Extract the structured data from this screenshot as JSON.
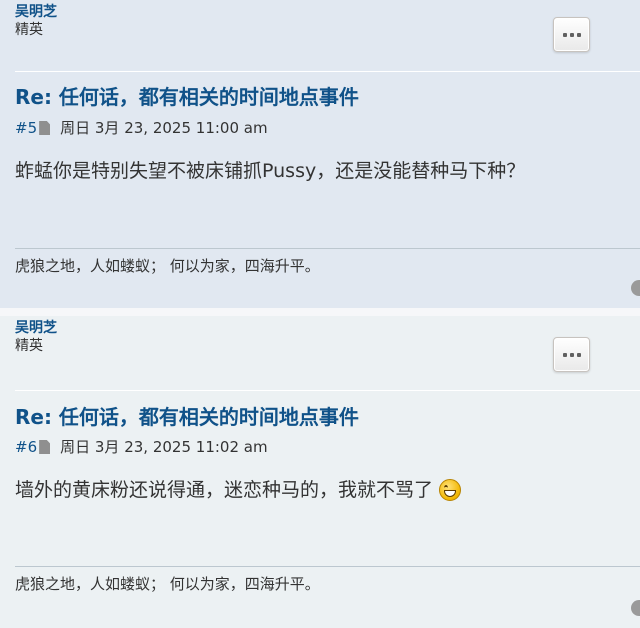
{
  "posts": [
    {
      "author": "吴明芝",
      "rank": "精英",
      "title": "Re: 任何话，都有相关的时间地点事件",
      "post_number": "#5",
      "date": "周日 3月 23, 2025 11:00 am",
      "content": "蚱蜢你是特别失望不被床铺抓Pussy，还是没能替种马下种？",
      "signature": "虎狼之地，人如蝼蚁； 何以为家，四海升平。"
    },
    {
      "author": "吴明芝",
      "rank": "精英",
      "title": "Re: 任何话，都有相关的时间地点事件",
      "post_number": "#6",
      "date": "周日 3月 23, 2025 11:02 am",
      "content": "墙外的黄床粉还说得通，迷恋种马的，我就不骂了",
      "content_emoji": "grinning-smiley-icon",
      "signature": "虎狼之地，人如蝼蚁； 何以为家，四海升平。"
    }
  ],
  "icons": {
    "post_link_icon": "document-icon",
    "menu_icon": "ellipsis-icon"
  },
  "colors": {
    "link_blue": "#105289",
    "post_bg_1": "#e1e8f1",
    "post_bg_2": "#ecf1f3"
  }
}
